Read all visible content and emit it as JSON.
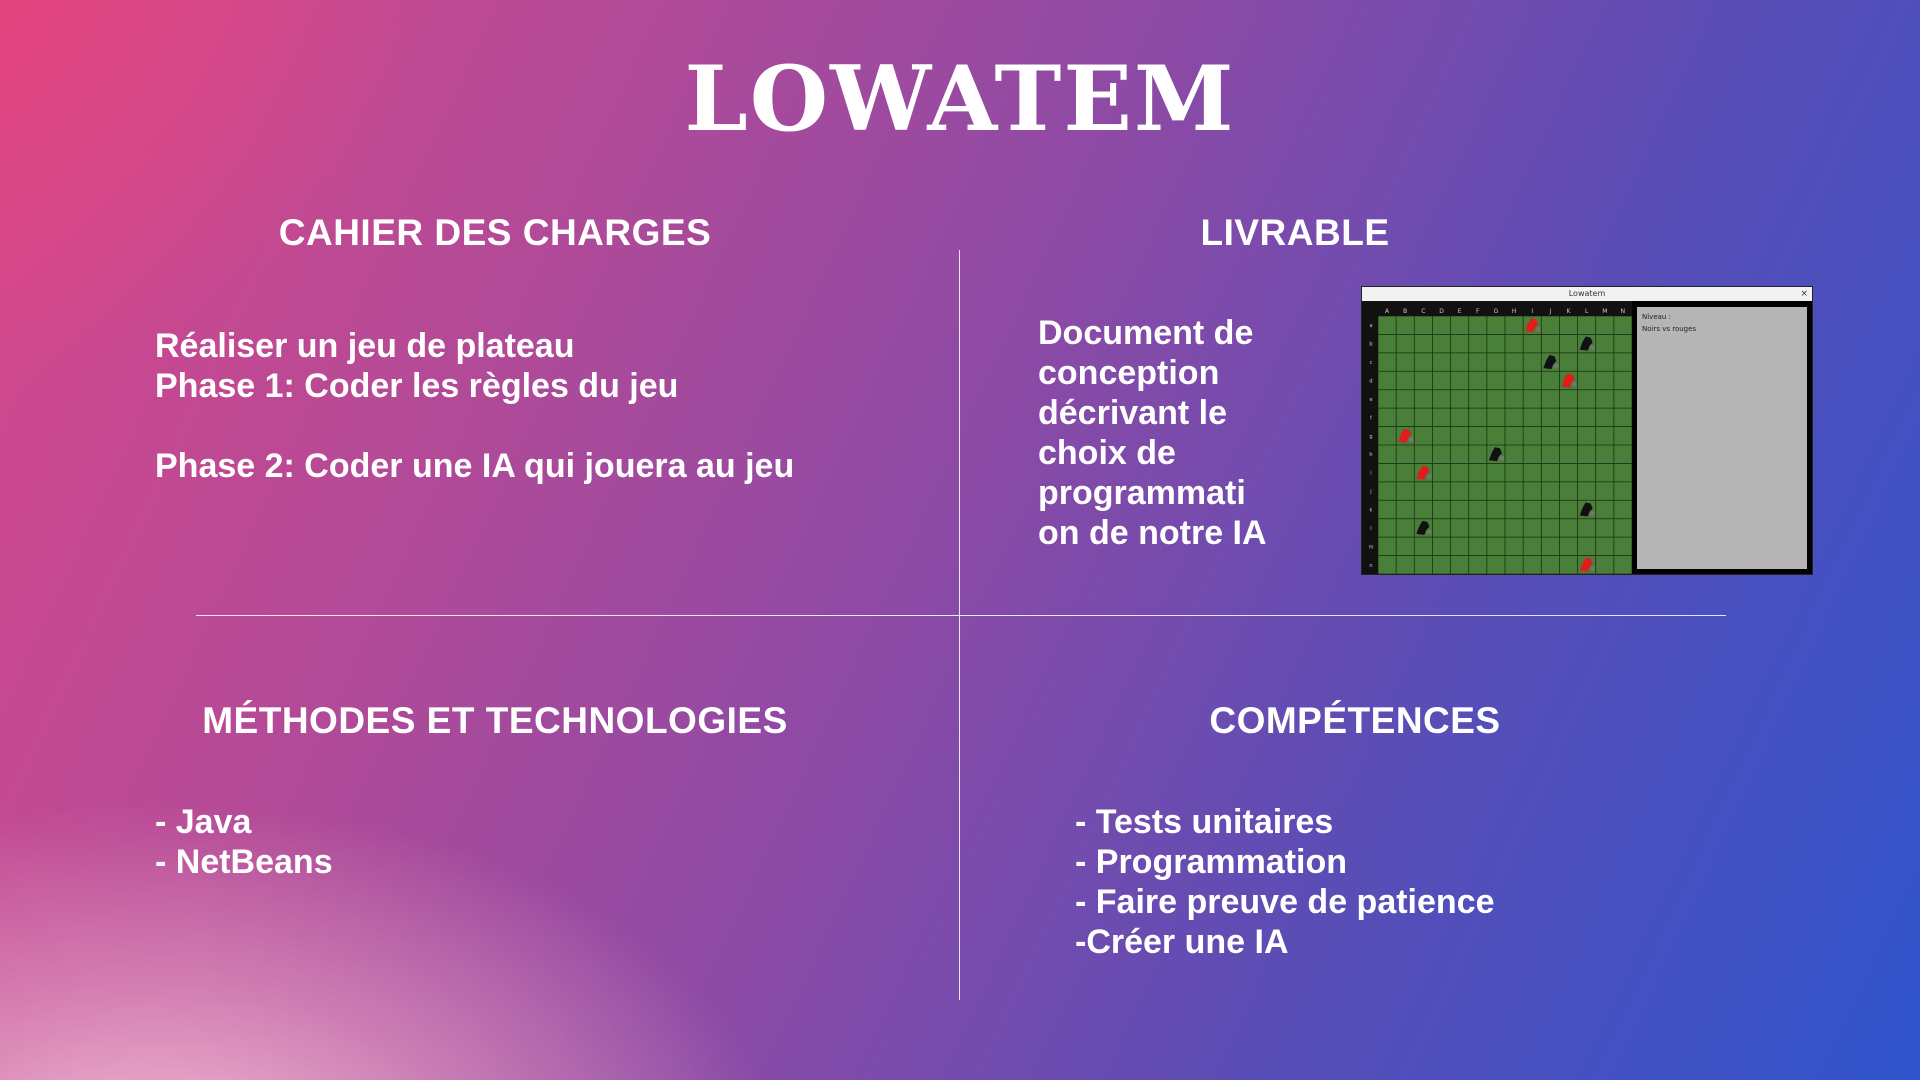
{
  "title": "LOWATEM",
  "sections": {
    "cahier": {
      "heading": "CAHIER DES CHARGES",
      "lines": [
        "Réaliser un jeu de plateau",
        "Phase 1: Coder les règles du jeu",
        "",
        "Phase 2: Coder une IA qui jouera au jeu"
      ]
    },
    "livrable": {
      "heading": "LIVRABLE",
      "lines": [
        "Document de",
        "conception",
        "décrivant le",
        "choix de",
        "programmati",
        "on de notre IA"
      ]
    },
    "methodes": {
      "heading": "MÉTHODES ET TECHNOLOGIES",
      "lines": [
        "- Java",
        "- NetBeans"
      ]
    },
    "competences": {
      "heading": "COMPÉTENCES",
      "lines": [
        "- Tests unitaires",
        "- Programmation",
        "- Faire preuve de patience",
        "-Créer une IA"
      ]
    }
  },
  "screenshot": {
    "window_title": "Lowatem",
    "close_glyph": "×",
    "panel_line1": "Niveau :",
    "panel_line2": "Noirs vs rouges",
    "columns": [
      "A",
      "B",
      "C",
      "D",
      "E",
      "F",
      "G",
      "H",
      "I",
      "J",
      "K",
      "L",
      "M",
      "N"
    ],
    "rows": [
      "a",
      "b",
      "c",
      "d",
      "e",
      "f",
      "g",
      "h",
      "i",
      "j",
      "k",
      "l",
      "m",
      "n"
    ],
    "board_color": "#4a7f3a",
    "red_color": "#e41b1b",
    "black_color": "#111111",
    "pieces": [
      {
        "color": "red",
        "row": 0,
        "col": 8
      },
      {
        "color": "black",
        "row": 1,
        "col": 11
      },
      {
        "color": "black",
        "row": 2,
        "col": 9
      },
      {
        "color": "red",
        "row": 3,
        "col": 10
      },
      {
        "color": "red",
        "row": 6,
        "col": 1
      },
      {
        "color": "black",
        "row": 7,
        "col": 6
      },
      {
        "color": "red",
        "row": 8,
        "col": 2
      },
      {
        "color": "black",
        "row": 10,
        "col": 11
      },
      {
        "color": "black",
        "row": 11,
        "col": 2
      },
      {
        "color": "red",
        "row": 13,
        "col": 11
      }
    ]
  }
}
